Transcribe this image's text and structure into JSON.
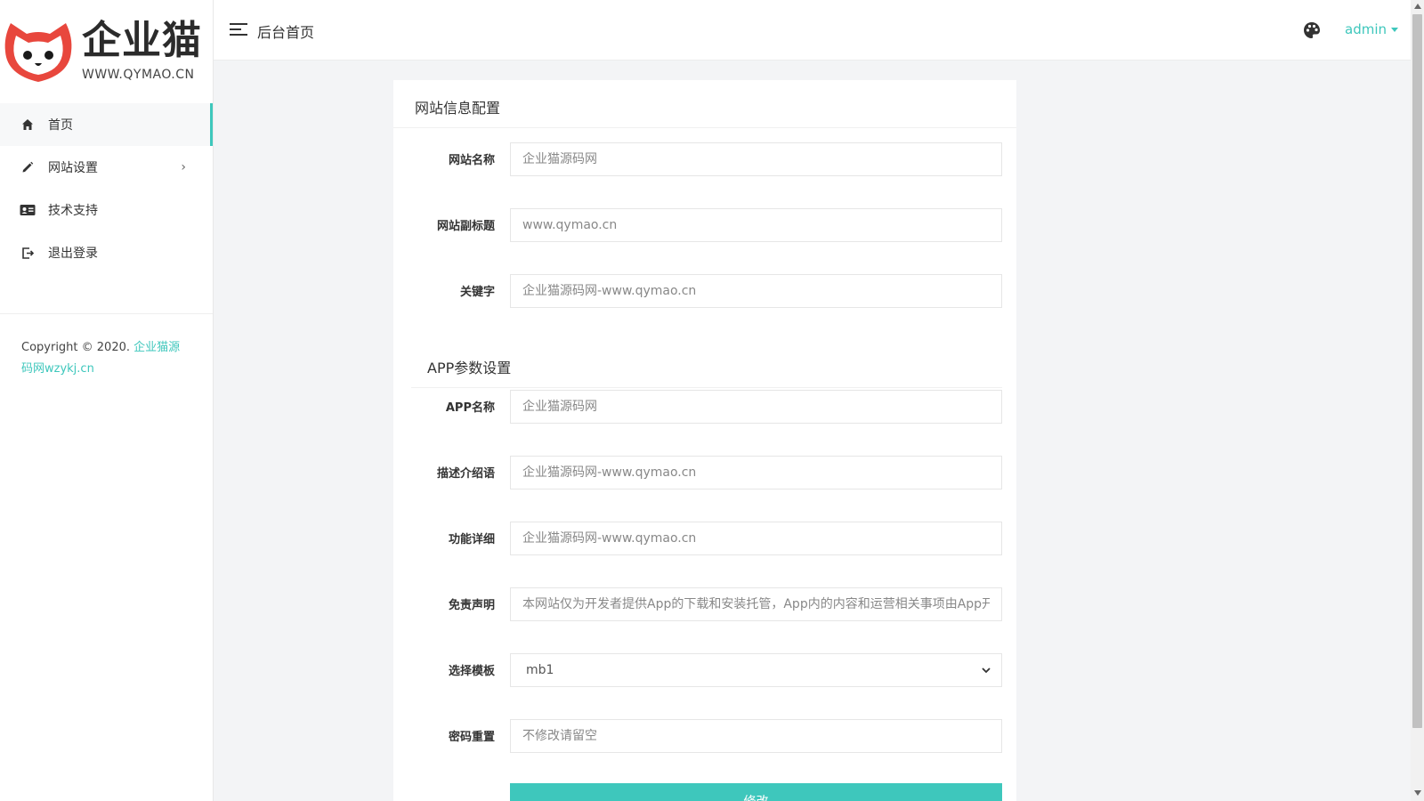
{
  "brand": {
    "name": "企业猫",
    "url_text": "WWW.QYMAO.CN",
    "accent": "#3ec7bc",
    "logo_red": "#e8473d"
  },
  "sidebar": {
    "items": [
      {
        "label": "首页",
        "icon": "home-icon"
      },
      {
        "label": "网站设置",
        "icon": "pencil-icon",
        "chevron": "›"
      },
      {
        "label": "技术支持",
        "icon": "id-card-icon"
      },
      {
        "label": "退出登录",
        "icon": "logout-icon"
      }
    ],
    "copyright_prefix": "Copyright © 2020.",
    "copyright_link": "企业猫源码网wzykj.cn"
  },
  "header": {
    "title": "后台首页",
    "user": "admin"
  },
  "form": {
    "card_title": "网站信息配置",
    "section_app": "APP参数设置",
    "fields": {
      "site_name": {
        "label": "网站名称",
        "placeholder": "企业猫源码网"
      },
      "site_subtitle": {
        "label": "网站副标题",
        "placeholder": "www.qymao.cn"
      },
      "keywords": {
        "label": "关键字",
        "placeholder": "企业猫源码网-www.qymao.cn"
      },
      "app_name": {
        "label": "APP名称",
        "placeholder": "企业猫源码网"
      },
      "description": {
        "label": "描述介绍语",
        "placeholder": "企业猫源码网-www.qymao.cn"
      },
      "features": {
        "label": "功能详细",
        "placeholder": "企业猫源码网-www.qymao.cn"
      },
      "disclaimer": {
        "label": "免责声明",
        "placeholder": "本网站仅为开发者提供App的下载和安装托管，App内的内容和运营相关事项由App开"
      },
      "template": {
        "label": "选择模板",
        "value": "mb1"
      },
      "password": {
        "label": "密码重置",
        "placeholder": "不修改请留空"
      }
    },
    "submit_label": "修改"
  }
}
